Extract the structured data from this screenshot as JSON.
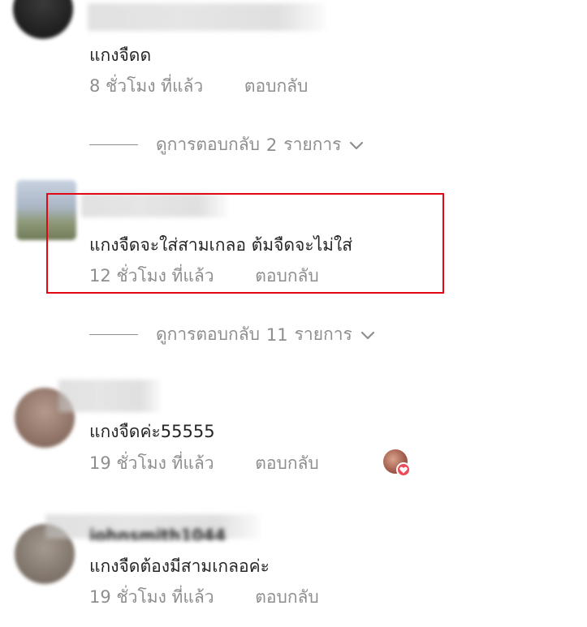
{
  "comments": [
    {
      "text": "แกงจืดด",
      "time": "8 ชั่วโมง ที่แล้ว",
      "reply": "ตอบกลับ",
      "view_replies": {
        "prefix": "ดูการตอบกลับ",
        "count": "2",
        "suffix": "รายการ"
      }
    },
    {
      "text": "แกงจืดจะใส่สามเกลอ ต้มจืดจะไม่ใส่",
      "time": "12 ชั่วโมง ที่แล้ว",
      "reply": "ตอบกลับ",
      "view_replies": {
        "prefix": "ดูการตอบกลับ",
        "count": "11",
        "suffix": "รายการ"
      }
    },
    {
      "text": "แกงจืดค่ะ55555",
      "time": "19 ชั่วโมง ที่แล้ว",
      "reply": "ตอบกลับ",
      "liked_by_author": true
    },
    {
      "username": "johnsmith1044",
      "text": "แกงจืดต้องมีสามเกลอค่ะ",
      "time": "19 ชั่วโมง ที่แล้ว",
      "reply": "ตอบกลับ"
    }
  ],
  "colors": {
    "text": "#262626",
    "secondary": "#8e8e8e",
    "highlight_border": "#e30613",
    "heart": "#ed4956"
  },
  "icons": {
    "chevron": "chevron-down-icon",
    "heart": "heart-icon"
  }
}
